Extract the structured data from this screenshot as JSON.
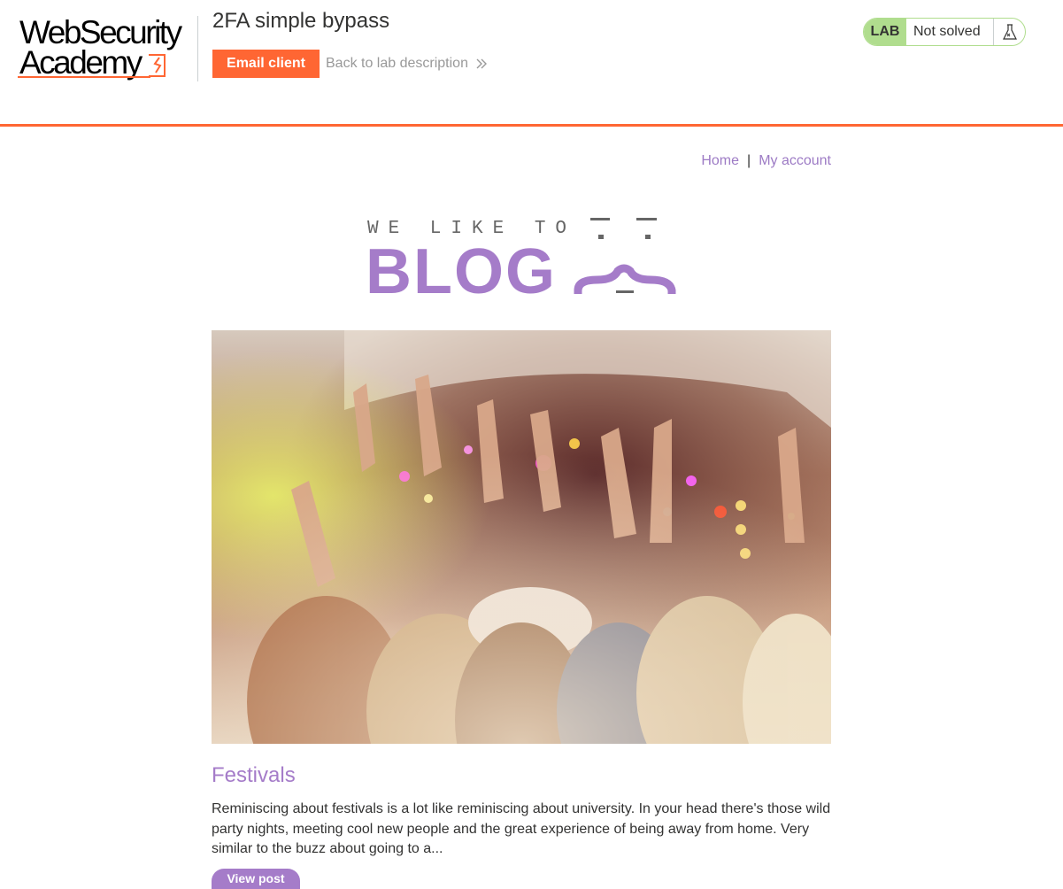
{
  "header": {
    "logo_line1": "WebSecurity",
    "logo_line2": "Academy",
    "lab_title": "2FA simple bypass",
    "email_client_label": "Email client",
    "back_link_label": "Back to lab description",
    "lab_badge": "LAB",
    "lab_status": "Not solved"
  },
  "nav": {
    "home": "Home",
    "separator": "|",
    "my_account": "My account"
  },
  "banner": {
    "line1": "WE LIKE TO",
    "line2": "BLOG"
  },
  "post": {
    "title": "Festivals",
    "excerpt": "Reminiscing about festivals is a lot like reminiscing about university. In your head there's those wild party nights, meeting cool new people and the great experience of being away from home. Very similar to the buzz about going to a...",
    "view_post_label": "View post"
  },
  "colors": {
    "accent_orange": "#ff6633",
    "blog_purple": "#a57cc9",
    "status_green": "#b0dd8e",
    "text": "#333332"
  },
  "icons": {
    "back": "chevron-double-right-icon",
    "lab": "flask-icon"
  }
}
